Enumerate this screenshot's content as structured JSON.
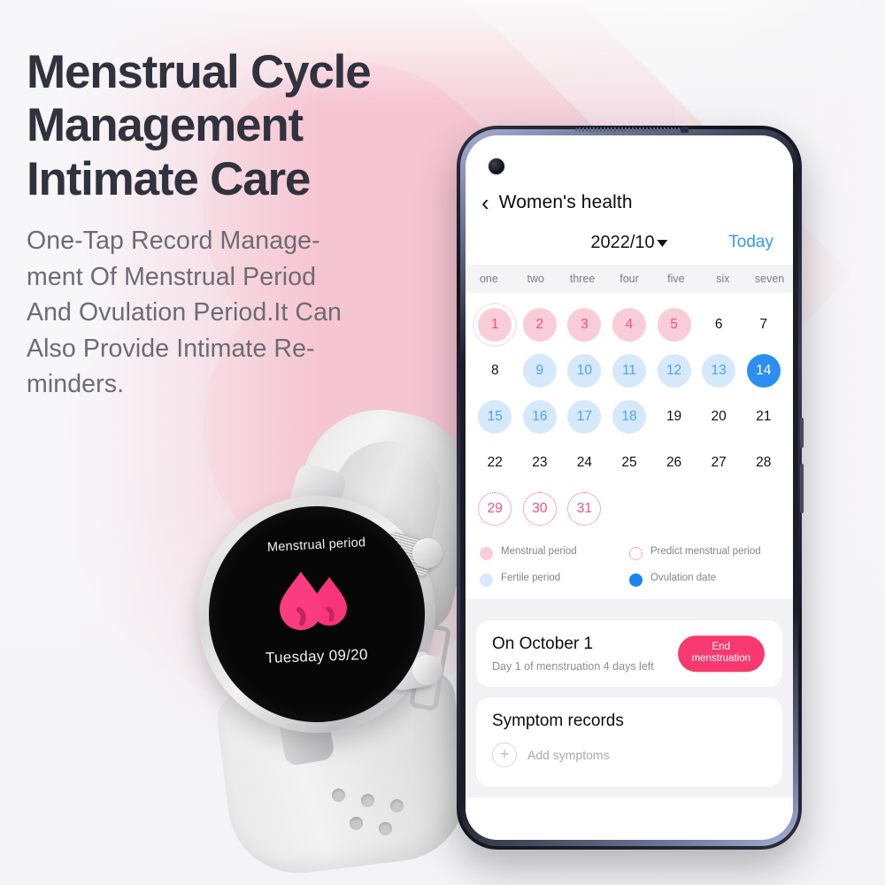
{
  "hero": {
    "headline_lines": [
      "Menstrual Cycle",
      "Management",
      "Intimate Care"
    ],
    "sub_lines": [
      "One-Tap Record Manage-",
      "ment Of Menstrual Period",
      "And Ovulation Period.It Can",
      "Also Provide Intimate Re-",
      "minders."
    ]
  },
  "watch": {
    "title": "Menstrual period",
    "date": "Tuesday 09/20",
    "icon": "blood-drops-icon",
    "accent": "#f9347a"
  },
  "phone": {
    "nav": {
      "back_icon": "chevron-left-icon",
      "title": "Women's health"
    },
    "subnav": {
      "month": "2022/10",
      "dropdown_icon": "caret-down-icon",
      "today_label": "Today"
    },
    "weekdays": [
      "one",
      "two",
      "three",
      "four",
      "five",
      "six",
      "seven"
    ],
    "calendar": {
      "days": [
        {
          "n": "1",
          "type": "menstrual",
          "selected": true
        },
        {
          "n": "2",
          "type": "menstrual"
        },
        {
          "n": "3",
          "type": "menstrual"
        },
        {
          "n": "4",
          "type": "menstrual"
        },
        {
          "n": "5",
          "type": "menstrual"
        },
        {
          "n": "6",
          "type": "plain"
        },
        {
          "n": "7",
          "type": "plain"
        },
        {
          "n": "8",
          "type": "plain"
        },
        {
          "n": "9",
          "type": "fertile"
        },
        {
          "n": "10",
          "type": "fertile"
        },
        {
          "n": "11",
          "type": "fertile"
        },
        {
          "n": "12",
          "type": "fertile"
        },
        {
          "n": "13",
          "type": "fertile"
        },
        {
          "n": "14",
          "type": "ovulation"
        },
        {
          "n": "15",
          "type": "fertile"
        },
        {
          "n": "16",
          "type": "fertile"
        },
        {
          "n": "17",
          "type": "fertile"
        },
        {
          "n": "18",
          "type": "fertile"
        },
        {
          "n": "19",
          "type": "plain"
        },
        {
          "n": "20",
          "type": "plain"
        },
        {
          "n": "21",
          "type": "plain"
        },
        {
          "n": "22",
          "type": "plain"
        },
        {
          "n": "23",
          "type": "plain"
        },
        {
          "n": "24",
          "type": "plain"
        },
        {
          "n": "25",
          "type": "plain"
        },
        {
          "n": "26",
          "type": "plain"
        },
        {
          "n": "27",
          "type": "plain"
        },
        {
          "n": "28",
          "type": "plain"
        },
        {
          "n": "29",
          "type": "predicted"
        },
        {
          "n": "30",
          "type": "predicted"
        },
        {
          "n": "31",
          "type": "predicted"
        }
      ]
    },
    "legend": [
      {
        "label": "Menstrual period",
        "swatch": "menstrual",
        "color": "#f9ccd9"
      },
      {
        "label": "Predict menstrual period",
        "swatch": "predicted",
        "color": "#ef4e8b"
      },
      {
        "label": "Fertile period",
        "swatch": "fertile",
        "color": "#d6e8fb"
      },
      {
        "label": "Ovulation date",
        "swatch": "ovulation",
        "color": "#1a84ef"
      }
    ],
    "status_card": {
      "title": "On October 1",
      "subtitle": "Day 1 of menstruation 4 days left",
      "button_line1": "End",
      "button_line2": "menstruation",
      "button_color": "#f7396f"
    },
    "symptom_card": {
      "title": "Symptom records",
      "add_label": "Add symptoms",
      "add_icon": "plus-circle-icon"
    }
  }
}
